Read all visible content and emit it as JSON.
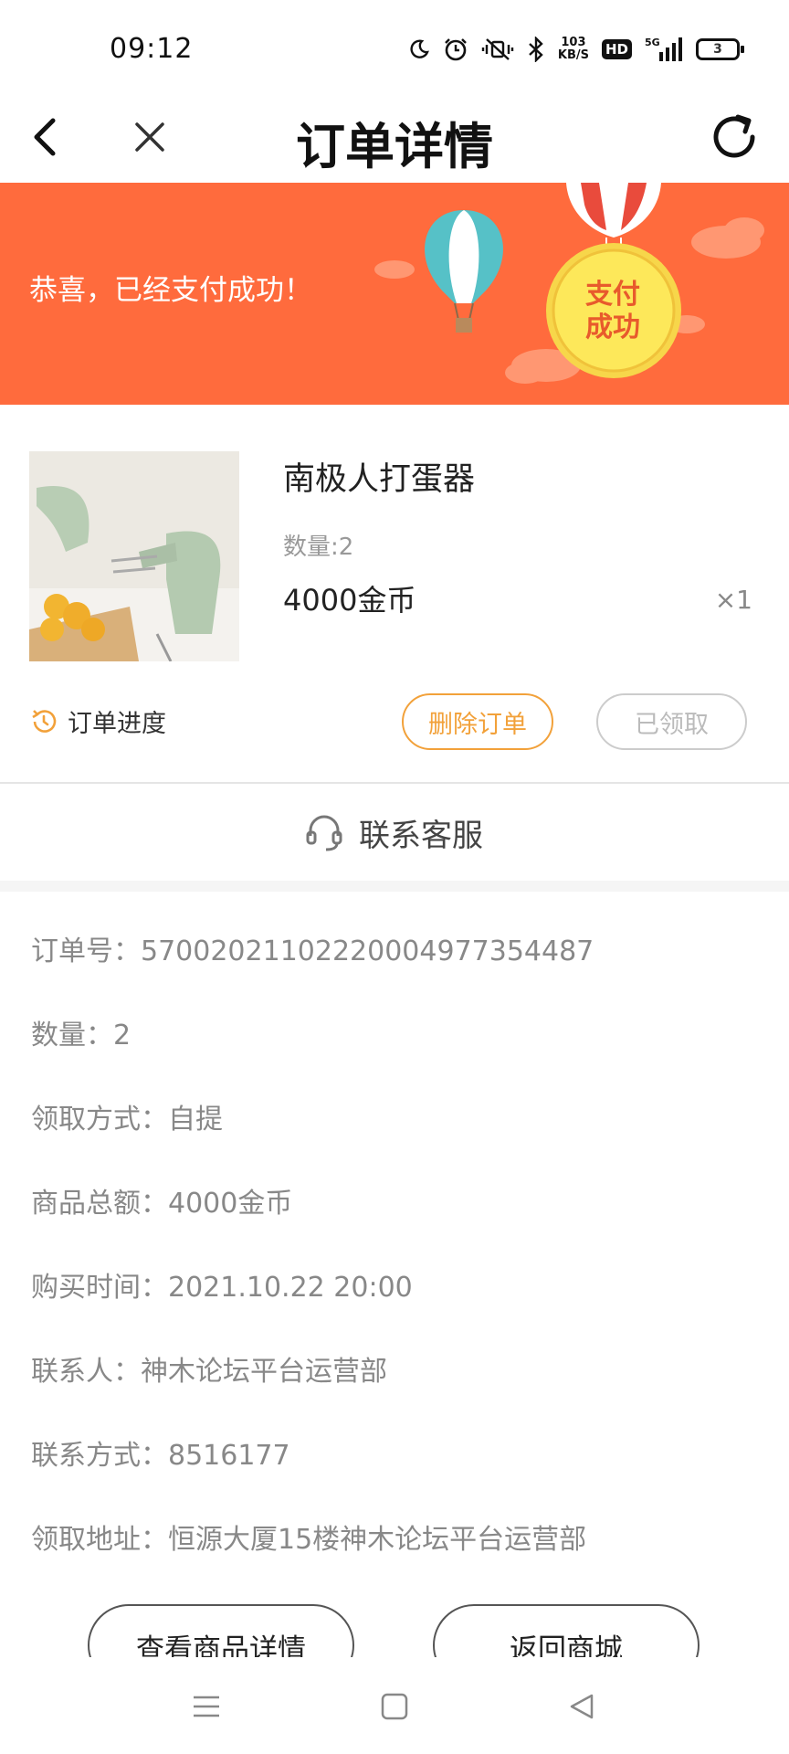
{
  "status_bar": {
    "time": "09:12",
    "speed_value": "103",
    "speed_unit": "KB/S",
    "hd_label": "HD",
    "network_label": "5G",
    "battery_level": "3",
    "icons": [
      "moon-icon",
      "alarm-icon",
      "vibrate-icon",
      "bluetooth-icon",
      "signal-icon",
      "battery-icon"
    ]
  },
  "header": {
    "title": "订单详情",
    "icons": [
      "back-icon",
      "close-icon",
      "refresh-icon"
    ]
  },
  "banner": {
    "message": "恭喜，已经支付成功！",
    "badge_line1": "支付",
    "badge_line2": "成功",
    "background": "#ff6b3d"
  },
  "product": {
    "name": "南极人打蛋器",
    "quantity": "数量:2",
    "price": "4000金币",
    "times": "×1"
  },
  "actions": {
    "progress_label": "订单进度",
    "delete_label": "删除订单",
    "received_label": "已领取",
    "accent": "#f2a13a"
  },
  "service": {
    "label": "联系客服"
  },
  "details": {
    "order_no": "订单号：5700202110222000 4977354487",
    "rows": [
      "订单号：57002021102220004977354487",
      "数量：2",
      "领取方式：自提",
      "商品总额：4000金币",
      "购买时间：2021.10.22 20:00",
      "联系人：神木论坛平台运营部",
      "联系方式：8516177",
      "领取地址：恒源大厦15楼神木论坛平台运营部"
    ]
  },
  "bottom": {
    "view_detail_label": "查看商品详情",
    "back_mall_label": "返回商城"
  },
  "navbar": {
    "icons": [
      "menu-icon",
      "home-icon",
      "back-nav-icon"
    ]
  }
}
